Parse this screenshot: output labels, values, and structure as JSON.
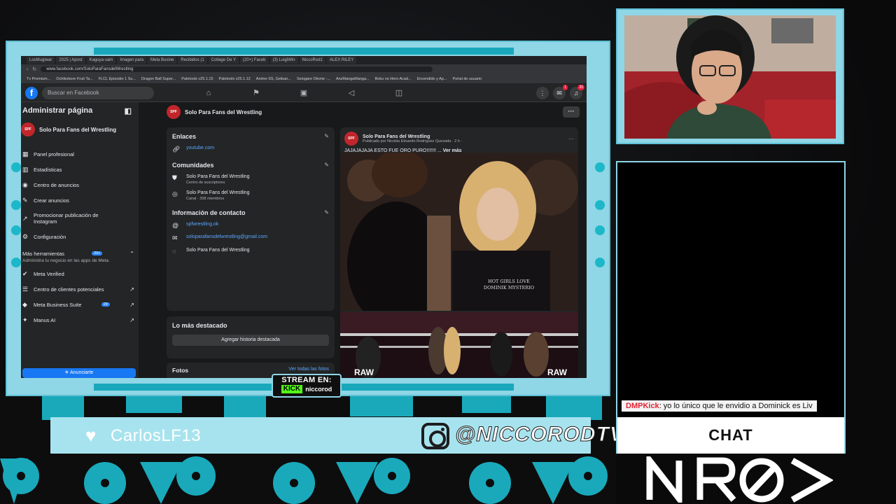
{
  "browser": {
    "tabs": [
      "LosMugiwar",
      "2025 | Apost",
      "Kaguya-sam",
      "Imagen para",
      "Meta Busine",
      "Recibidos (1",
      "Collage De Y",
      "(20+) Faceb",
      "(3) LuigiWin",
      "NiccoRod1",
      "ALEX RILEY"
    ],
    "url": "www.facebook.com/SoloParaFansdelWrestling",
    "bookmarks": [
      "Tv Premium...",
      "Ochikobore Fruit Ta...",
      "FLCL Episodio 1 Su...",
      "Dragon Ball Super...",
      "Paletools v25.1.15",
      "Paletools v25.1.12",
      "Anime-SS, Geiban...",
      "Seiogare Otome -...",
      "AnzMangaManga...",
      "Boku no Hero Acad...",
      "Encendido y Ap...",
      "Portal de usuario"
    ]
  },
  "fb": {
    "search_placeholder": "Buscar en Facebook",
    "nav_icons": [
      "home-icon",
      "flag-icon",
      "video-icon",
      "megaphone-icon",
      "marketplace-icon"
    ],
    "messenger_badge": "1",
    "notifications_badge": "20"
  },
  "sidebar": {
    "title": "Administrar página",
    "page_name": "Solo Para Fans del Wrestling",
    "avatar_text": "SPF",
    "items": [
      {
        "label": "Panel profesional",
        "icon": "dashboard-icon"
      },
      {
        "label": "Estadísticas",
        "icon": "chart-icon"
      },
      {
        "label": "Centro de anuncios",
        "icon": "ads-icon"
      },
      {
        "label": "Crear anuncios",
        "icon": "create-icon"
      },
      {
        "label": "Promocionar publicación de Instagram",
        "icon": "promote-icon"
      },
      {
        "label": "Configuración",
        "icon": "gear-icon"
      }
    ],
    "more_tools": "Más herramientas",
    "more_tools_badge": "20+",
    "more_tools_sub": "Administra tu negocio en las apps de Meta.",
    "tools": [
      {
        "label": "Meta Verified",
        "badge": ""
      },
      {
        "label": "Centro de clientes potenciales",
        "badge": ""
      },
      {
        "label": "Meta Business Suite",
        "badge": "29"
      },
      {
        "label": "Manus AI",
        "badge": ""
      }
    ],
    "promote_button": "Anunciarte"
  },
  "main": {
    "page_name": "Solo Para Fans del Wrestling",
    "links_title": "Enlaces",
    "link": "youtube.com",
    "communities_title": "Comunidades",
    "communities": [
      {
        "name": "Solo Para Fans del Wrestling",
        "sub": "Centro de suscriptores"
      },
      {
        "name": "Solo Para Fans del Wrestling",
        "sub": "Canal · 308 miembros"
      }
    ],
    "contact_title": "Información de contacto",
    "instagram": "spfwrestling.ok",
    "email": "soloparafansdelwrestling@gmail.com",
    "messenger": "Solo Para Fans del Wrestling",
    "highlights_title": "Lo más destacado",
    "highlights_button": "Agregar historia destacada",
    "photos_title": "Fotos",
    "photos_link": "Ver todas las fotos"
  },
  "post": {
    "author": "Solo Para Fans del Wrestling",
    "meta": "Publicado por Nicolás Eduardo Rodríguez Quezada · 2 h ·",
    "text": "JAJAJAJAJA ESTO FUE ORO PURO!!!!!!! ...",
    "see_more": "Ver más",
    "shirt_text_1": "HOT GIRLS LOVE",
    "shirt_text_2": "DOMINIK MYSTERIO"
  },
  "overlay": {
    "stream_title": "STREAM EN:",
    "kick_label": "KICK",
    "kick_user": "niccorod",
    "credit_user": "CarlosLF13",
    "instagram_handle": "@NICCORODTV",
    "chat_nick": "DMPKick",
    "chat_text": ": yo lo único que le envidio a Dominick es Liv",
    "chat_label": "CHAT"
  },
  "colors": {
    "frame": "#8fd6e6",
    "accent": "#1cb8c9",
    "fb_blue": "#1877f2",
    "kick_green": "#53fc18"
  }
}
